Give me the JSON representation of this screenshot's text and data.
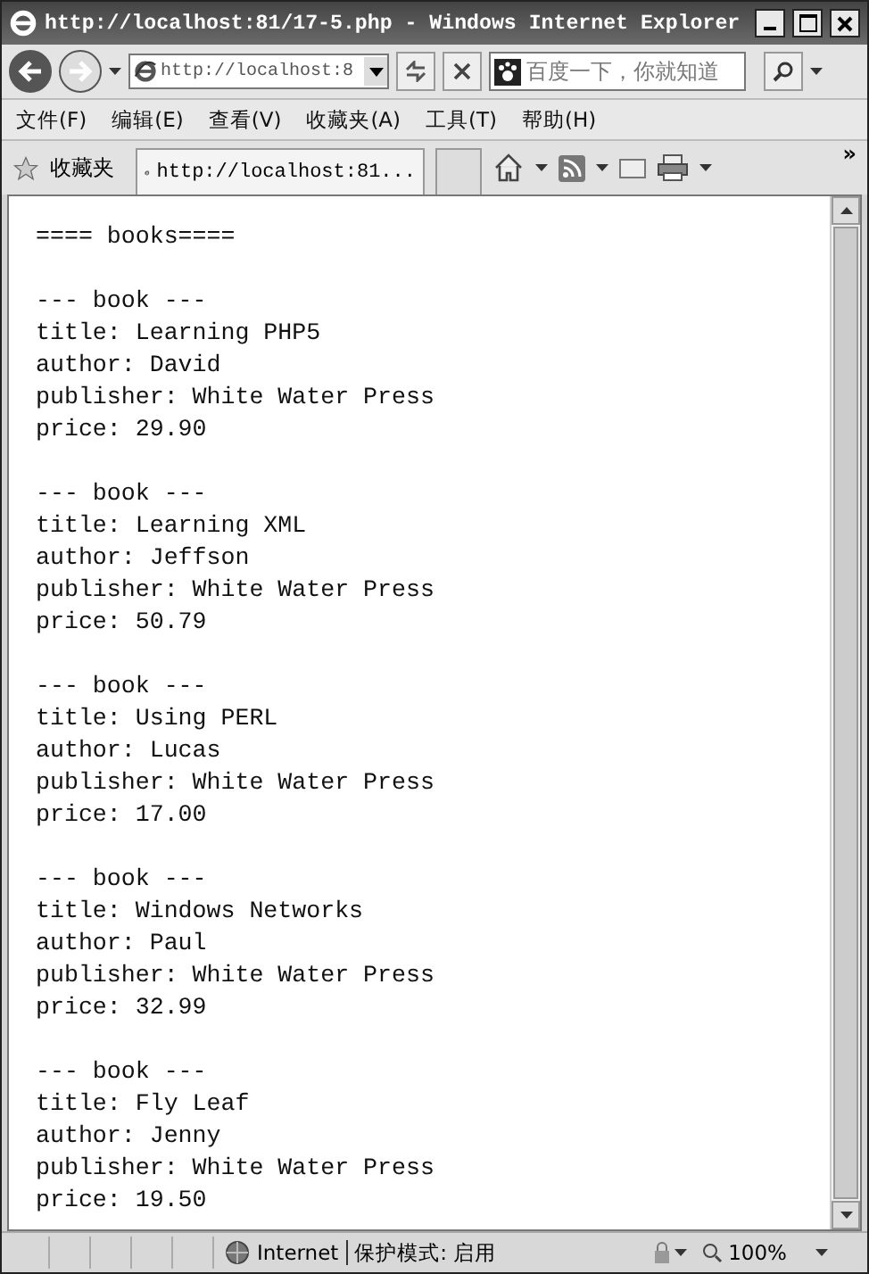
{
  "window": {
    "title": "http://localhost:81/17-5.php - Windows Internet Explorer"
  },
  "address": {
    "value": "http://localhost:8"
  },
  "search": {
    "placeholder": "百度一下，你就知道"
  },
  "menu": [
    "文件(F)",
    "编辑(E)",
    "查看(V)",
    "收藏夹(A)",
    "工具(T)",
    "帮助(H)"
  ],
  "favorites": {
    "label": "收藏夹",
    "tab": "http://localhost:81...",
    "more": "»"
  },
  "content": {
    "heading": "==== books====",
    "books": [
      {
        "header": "--- book ---",
        "lines": [
          "title: Learning PHP5",
          "author: David",
          "publisher: White Water Press",
          "price: 29.90"
        ]
      },
      {
        "header": "--- book ---",
        "lines": [
          "title: Learning XML",
          "author: Jeffson",
          "publisher: White Water Press",
          "price: 50.79"
        ]
      },
      {
        "header": "--- book ---",
        "lines": [
          "title: Using PERL",
          "author: Lucas",
          "publisher: White Water Press",
          "price: 17.00"
        ]
      },
      {
        "header": "--- book ---",
        "lines": [
          "title: Windows Networks",
          "author: Paul",
          "publisher: White Water Press",
          "price: 32.99"
        ]
      },
      {
        "header": "--- book ---",
        "lines": [
          "title: Fly Leaf",
          "author: Jenny",
          "publisher: White Water Press",
          "price: 19.50"
        ]
      }
    ]
  },
  "status_bar": {
    "zone": "Internet",
    "mode": "保护模式: 启用",
    "zoom": "100%"
  }
}
